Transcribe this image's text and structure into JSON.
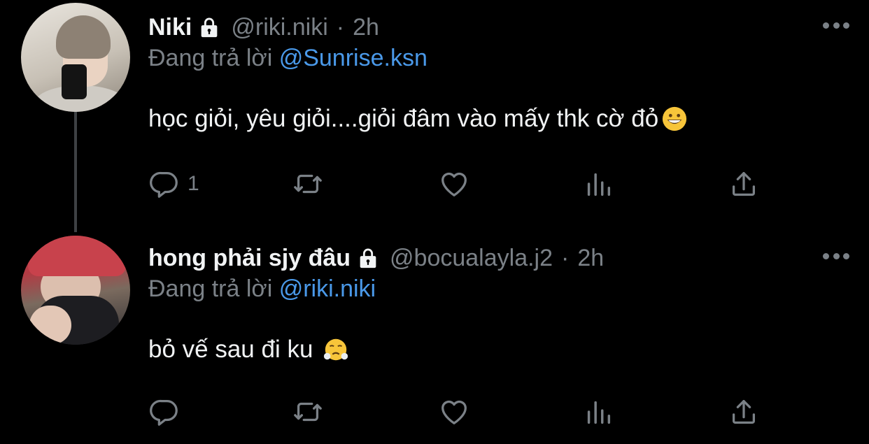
{
  "tweets": [
    {
      "name": "Niki",
      "handle": "@riki.niki",
      "separator": "·",
      "time": "2h",
      "reply_prefix": "Đang trả lời ",
      "reply_to": "@Sunrise.ksn",
      "text": "học giỏi, yêu giỏi....giỏi đâm vào mấy thk cờ đỏ",
      "emoji": "grinning-face",
      "reply_count": "1",
      "verified_lock": true
    },
    {
      "name": "hong phải sjy đâu",
      "handle": "@bocualayla.j2",
      "separator": "·",
      "time": "2h",
      "reply_prefix": "Đang trả lời ",
      "reply_to": "@riki.niki",
      "text": "bỏ vế sau đi ku ",
      "emoji": "face-with-steam-from-nose",
      "reply_count": "",
      "verified_lock": true
    }
  ],
  "colors": {
    "background": "#000000",
    "text": "#f1f3f4",
    "muted": "#7b8187",
    "mention": "#4a99e9",
    "thread_line": "#3e4144"
  },
  "icons": [
    "lock-icon",
    "more-icon",
    "reply-icon",
    "retweet-icon",
    "like-icon",
    "views-icon",
    "share-icon"
  ]
}
